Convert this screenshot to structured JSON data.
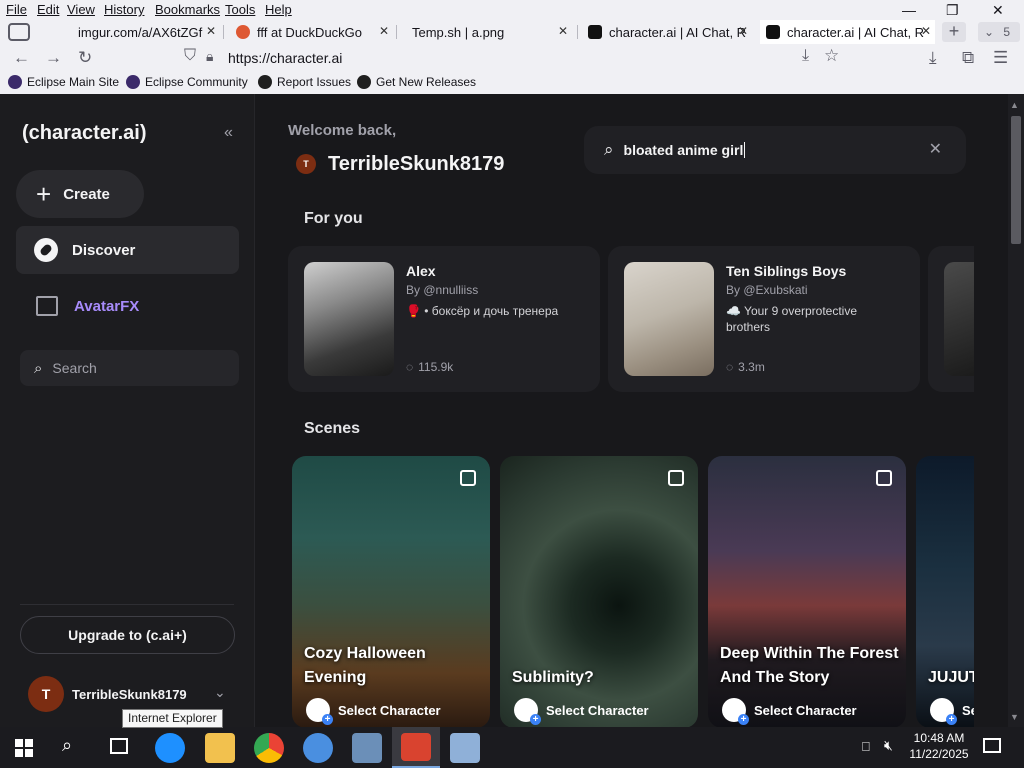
{
  "menu": [
    "File",
    "Edit",
    "View",
    "History",
    "Bookmarks",
    "Tools",
    "Help"
  ],
  "tabs": [
    {
      "label": "imgur.com/a/AX6tZGf",
      "color": "#2b2b2b"
    },
    {
      "label": "fff at DuckDuckGo",
      "color": "#de5833"
    },
    {
      "label": "Temp.sh | a.png",
      "color": "#ffffff"
    },
    {
      "label": "character.ai | AI Chat, R",
      "color": "#111111"
    },
    {
      "label": "character.ai | AI Chat, R",
      "color": "#111111"
    }
  ],
  "tab_count": "5",
  "url": "https://character.ai",
  "bookmarks": [
    "Eclipse Main Site",
    "Eclipse Community",
    "Report Issues",
    "Get New Releases"
  ],
  "sidebar": {
    "logo": "(character.ai)",
    "create": "Create",
    "discover": "Discover",
    "avatarfx": "AvatarFX",
    "search": "Search",
    "upgrade": "Upgrade to (c.ai+)",
    "user": "TerribleSkunk8179",
    "avatar_letter": "T"
  },
  "main": {
    "welcome": "Welcome back,",
    "username": "TerribleSkunk8179",
    "avatar_letter": "T",
    "search_value": "bloated anime girl",
    "for_you": "For you",
    "scenes": "Scenes"
  },
  "cards": [
    {
      "name": "Alex",
      "by": "By @nnulliiss",
      "desc": "🥊 • боксёр и дочь тренера",
      "count": "115.9k"
    },
    {
      "name": "Ten Siblings Boys",
      "by": "By @Exubskati",
      "desc": "☁️ Your 9 overprotective brothers",
      "count": "3.3m"
    }
  ],
  "scenes": [
    {
      "title": "Cozy Halloween Evening",
      "select": "Select Character"
    },
    {
      "title": "Sublimity?",
      "select": "Select Character"
    },
    {
      "title": "Deep Within The Forest And The Story",
      "select": "Select Character"
    },
    {
      "title": "JUJUT",
      "select": "Se"
    }
  ],
  "tooltip": "Internet Explorer",
  "clock": {
    "time": "10:48 AM",
    "date": "11/22/2025"
  }
}
